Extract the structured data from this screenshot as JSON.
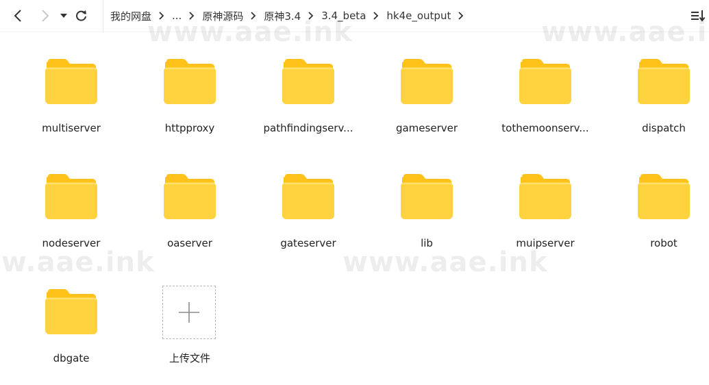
{
  "breadcrumb": {
    "items": [
      {
        "label": "我的网盘"
      },
      {
        "label": "..."
      },
      {
        "label": "原神源码"
      },
      {
        "label": "原神3.4"
      },
      {
        "label": "3.4_beta"
      },
      {
        "label": "hk4e_output"
      }
    ]
  },
  "icons": {
    "back": "chevron-left-icon",
    "forward": "chevron-right-icon",
    "history": "caret-down-icon",
    "refresh": "refresh-icon",
    "sort": "sort-icon",
    "folder": "folder-icon",
    "upload": "plus-icon"
  },
  "folders": [
    {
      "name": "multiserver"
    },
    {
      "name": "httpproxy"
    },
    {
      "name": "pathfindingserv..."
    },
    {
      "name": "gameserver"
    },
    {
      "name": "tothemoonserv..."
    },
    {
      "name": "dispatch"
    },
    {
      "name": "nodeserver"
    },
    {
      "name": "oaserver"
    },
    {
      "name": "gateserver"
    },
    {
      "name": "lib"
    },
    {
      "name": "muipserver"
    },
    {
      "name": "robot"
    },
    {
      "name": "dbgate"
    }
  ],
  "upload": {
    "label": "上传文件"
  },
  "watermarks": [
    "www.aae.ink",
    "www.aae.in",
    "w.aae.ink",
    "www.aae.ink"
  ],
  "colors": {
    "folder_body": "#FFD23F",
    "folder_back": "#FFC21A",
    "background": "#FFFFFF"
  }
}
